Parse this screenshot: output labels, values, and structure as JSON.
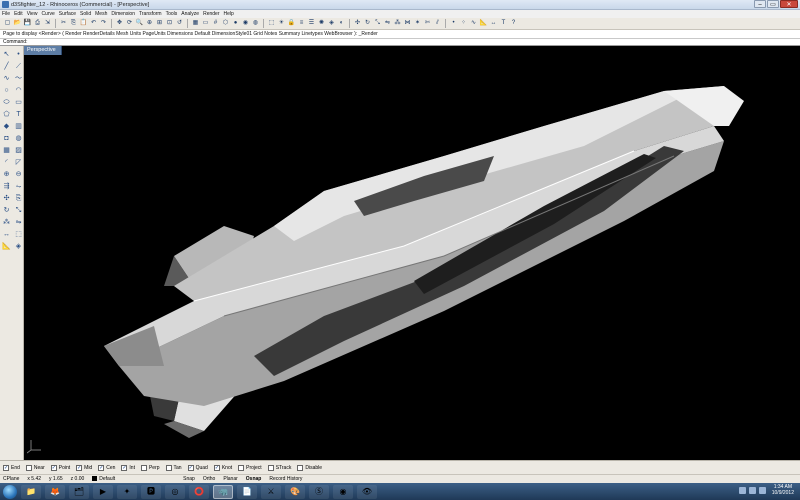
{
  "window": {
    "title": "d3Sfighter_12 - Rhinoceros (Commercial) - [Perspective]",
    "buttons": [
      "–",
      "▭",
      "✕"
    ]
  },
  "menu": [
    "File",
    "Edit",
    "View",
    "Curve",
    "Surface",
    "Solid",
    "Mesh",
    "Dimension",
    "Transform",
    "Tools",
    "Analyze",
    "Render",
    "Help"
  ],
  "history_line": "Page to display <Render> ( Render RenderDetails Mesh Units PageUnits Dimensions Default DimensionStyle01 Grid Notes Summary Linetypes WebBrowser ): _Render",
  "command_prompt": "Command:",
  "viewport": {
    "tab_label": "Perspective",
    "background": "#000000"
  },
  "osnaps": [
    {
      "label": "End",
      "checked": true
    },
    {
      "label": "Near",
      "checked": false
    },
    {
      "label": "Point",
      "checked": true
    },
    {
      "label": "Mid",
      "checked": true
    },
    {
      "label": "Cen",
      "checked": true
    },
    {
      "label": "Int",
      "checked": true
    },
    {
      "label": "Perp",
      "checked": false
    },
    {
      "label": "Tan",
      "checked": false
    },
    {
      "label": "Quad",
      "checked": true
    },
    {
      "label": "Knot",
      "checked": true
    },
    {
      "label": "Project",
      "checked": false
    },
    {
      "label": "STrack",
      "checked": false
    },
    {
      "label": "Disable",
      "checked": false
    }
  ],
  "status": {
    "cplane": "CPlane",
    "x": "x 5.42",
    "y": "y 1.65",
    "z": "z 0.00",
    "layer": "Default",
    "snap": "Snap",
    "ortho": "Ortho",
    "planar": "Planar",
    "osnap": "Osnap",
    "record_history": "Record History"
  },
  "taskbar": {
    "time": "1:34 AM",
    "date": "10/9/2012",
    "apps": [
      "folder",
      "firefox",
      "explorer",
      "media",
      "game",
      "photoshop",
      "chrome",
      "opera",
      "rhino",
      "acrobat",
      "game2",
      "paint",
      "skype",
      "chrome2",
      "eye"
    ]
  }
}
